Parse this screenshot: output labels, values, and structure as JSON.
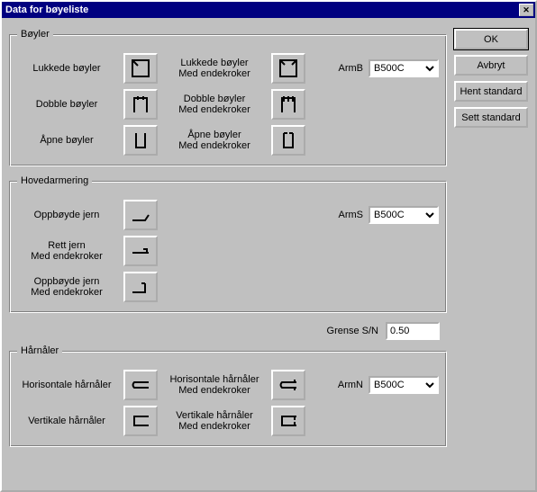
{
  "window": {
    "title": "Data for bøyeliste"
  },
  "sidebar": {
    "ok": "OK",
    "cancel": "Avbryt",
    "load_std": "Hent standard",
    "set_std": "Sett standard"
  },
  "group_boyler": {
    "legend": "Bøyler",
    "row1": {
      "a": "Lukkede bøyler",
      "b": "Lukkede bøyler\nMed endekroker"
    },
    "row2": {
      "a": "Dobble bøyler",
      "b": "Dobble bøyler\nMed endekroker"
    },
    "row3": {
      "a": "Åpne bøyler",
      "b": "Åpne bøyler\nMed endekroker"
    },
    "arm_label": "ArmB",
    "arm_value": "B500C"
  },
  "group_hoved": {
    "legend": "Hovedarmering",
    "row1": {
      "a": "Oppbøyde jern"
    },
    "row2": {
      "a": "Rett jern\nMed endekroker"
    },
    "row3": {
      "a": "Oppbøyde jern\nMed endekroker"
    },
    "arm_label": "ArmS",
    "arm_value": "B500C"
  },
  "grense": {
    "label": "Grense S/N",
    "value": "0.50"
  },
  "group_harn": {
    "legend": "Hårnåler",
    "row1": {
      "a": "Horisontale hårnåler",
      "b": "Horisontale hårnåler\nMed endekroker"
    },
    "row2": {
      "a": "Vertikale hårnåler",
      "b": "Vertikale hårnåler\nMed endekroker"
    },
    "arm_label": "ArmN",
    "arm_value": "B500C"
  }
}
